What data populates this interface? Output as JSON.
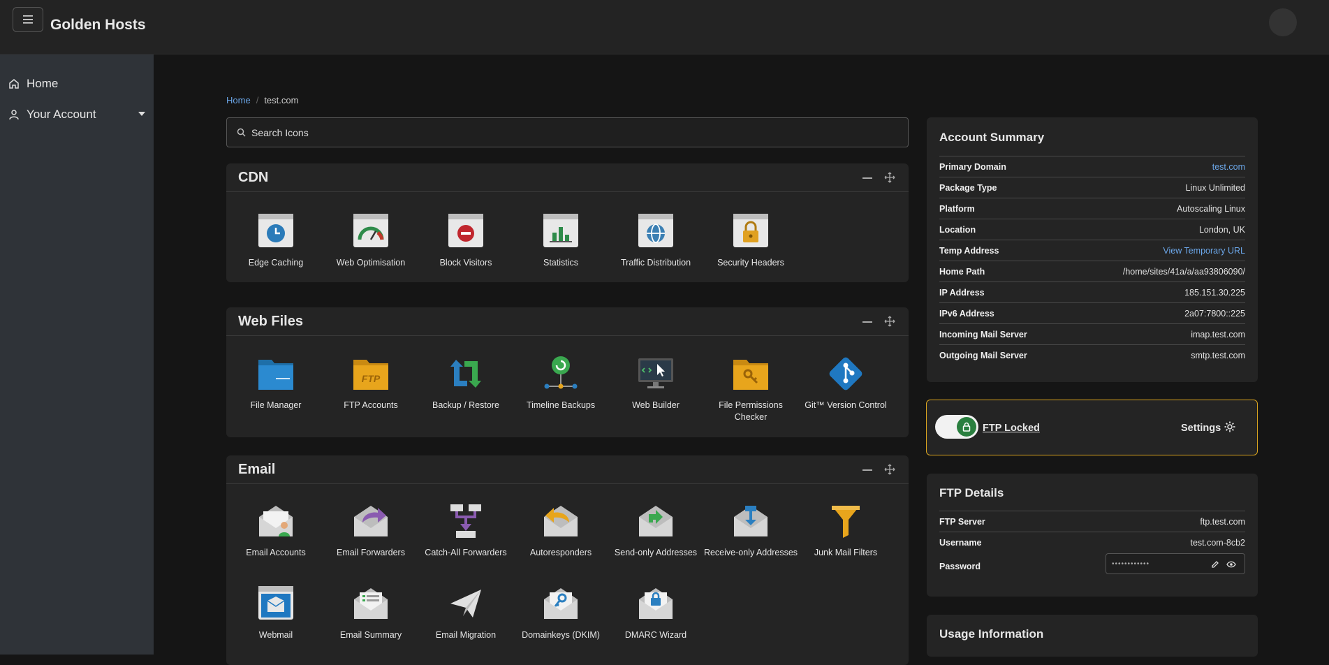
{
  "app": {
    "brand": "Golden Hosts",
    "menu_icon": "hamburger-icon"
  },
  "sidebar": {
    "items": [
      {
        "label": "Home",
        "icon": "home-icon"
      },
      {
        "label": "Your Account",
        "icon": "user-icon"
      }
    ]
  },
  "breadcrumb": {
    "home": "Home",
    "current": "test.com"
  },
  "search": {
    "placeholder": "Search Icons"
  },
  "sections": {
    "cdn": {
      "title": "CDN",
      "tiles": [
        "Edge Caching",
        "Web Optimisation",
        "Block Visitors",
        "Statistics",
        "Traffic Distribution",
        "Security Headers"
      ]
    },
    "web_files": {
      "title": "Web Files",
      "tiles": [
        "File Manager",
        "FTP Accounts",
        "Backup / Restore",
        "Timeline Backups",
        "Web Builder",
        "File Permissions Checker",
        "Git™ Version Control"
      ]
    },
    "email": {
      "title": "Email",
      "tiles": [
        "Email Accounts",
        "Email Forwarders",
        "Catch-All Forwarders",
        "Autoresponders",
        "Send-only Addresses",
        "Receive-only Addresses",
        "Junk Mail Filters",
        "Webmail",
        "Email Summary",
        "Email Migration",
        "Domainkeys (DKIM)",
        "DMARC Wizard"
      ]
    }
  },
  "account_summary": {
    "title": "Account Summary",
    "rows": [
      {
        "key": "Primary Domain",
        "value": "test.com"
      },
      {
        "key": "Package Type",
        "value": "Linux Unlimited"
      },
      {
        "key": "Platform",
        "value": "Autoscaling Linux"
      },
      {
        "key": "Location",
        "value": "London, UK"
      },
      {
        "key": "Temp Address",
        "value": "View Temporary URL"
      },
      {
        "key": "Home Path",
        "value": "/home/sites/41a/a/aa93806090/"
      },
      {
        "key": "IP Address",
        "value": "185.151.30.225"
      },
      {
        "key": "IPv6 Address",
        "value": "2a07:7800::225"
      },
      {
        "key": "Incoming Mail Server",
        "value": "imap.test.com"
      },
      {
        "key": "Outgoing Mail Server",
        "value": "smtp.test.com"
      }
    ]
  },
  "ftp_lock": {
    "label": "FTP Locked",
    "settings": "Settings"
  },
  "ftp_details": {
    "title": "FTP Details",
    "server_key": "FTP Server",
    "server_value": "ftp.test.com",
    "username_key": "Username",
    "username_value": "test.com-8cb2",
    "password_key": "Password",
    "password_mask": "••••••••••••"
  },
  "usage": {
    "title": "Usage Information"
  },
  "colors": {
    "accent_link": "#6ba6e8",
    "lock_border": "#d9a420",
    "toggle_on": "#2a7f3f"
  }
}
